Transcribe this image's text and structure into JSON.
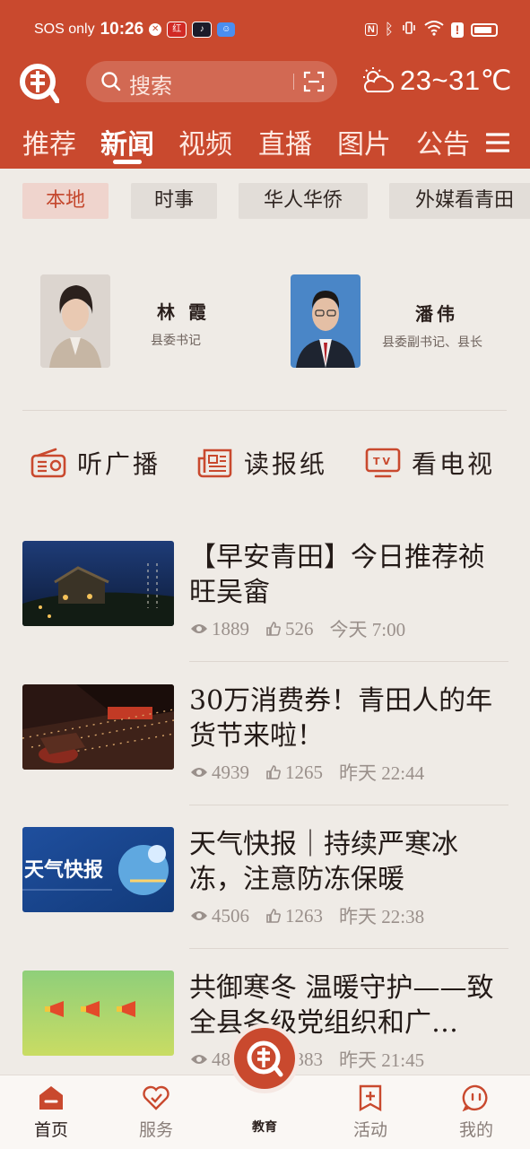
{
  "status_bar": {
    "carrier": "SOS only",
    "time": "10:26",
    "mini_icons": [
      "shield-x-icon",
      "app-badge-1-icon",
      "app-badge-2-icon",
      "app-badge-3-icon"
    ],
    "right_icons": [
      "nfc-icon",
      "bluetooth-icon",
      "vibrate-icon",
      "wifi-icon",
      "alert-icon",
      "battery-icon"
    ]
  },
  "header": {
    "search_placeholder": "搜索",
    "temperature": "23~31℃",
    "weather_icon": "partly-cloudy-icon"
  },
  "main_tabs": [
    {
      "label": "推荐",
      "active": false
    },
    {
      "label": "新闻",
      "active": true
    },
    {
      "label": "视频",
      "active": false
    },
    {
      "label": "直播",
      "active": false
    },
    {
      "label": "图片",
      "active": false
    },
    {
      "label": "公告",
      "active": false
    }
  ],
  "sub_tabs": [
    {
      "label": "本地",
      "active": true
    },
    {
      "label": "时事",
      "active": false
    },
    {
      "label": "华人华侨",
      "active": false
    },
    {
      "label": "外媒看青田",
      "active": false
    }
  ],
  "leaders": [
    {
      "name": "林 霞",
      "title": "县委书记"
    },
    {
      "name": "潘伟",
      "title": "县委副书记、县长"
    }
  ],
  "media_links": [
    {
      "label": "听广播",
      "icon": "radio-icon"
    },
    {
      "label": "读报纸",
      "icon": "newspaper-icon"
    },
    {
      "label": "看电视",
      "icon": "tv-icon"
    }
  ],
  "news": [
    {
      "title": "【早安青田】今日推荐祯旺吴畲",
      "views": "1889",
      "likes": "526",
      "time": "今天  7:00",
      "thumb_text": ""
    },
    {
      "title": "30万消费券！青田人的年货节来啦！",
      "views": "4939",
      "likes": "1265",
      "time": "昨天  22:44",
      "thumb_text": ""
    },
    {
      "title": "天气快报｜持续严寒冰冻，注意防冻保暖",
      "views": "4506",
      "likes": "1263",
      "time": "昨天  22:38",
      "thumb_text": "天气快报"
    },
    {
      "title": "共御寒冬 温暖守护——致全县各级党组织和广…",
      "views": "4818",
      "likes": "1383",
      "time": "昨天  21:45",
      "thumb_text": ""
    }
  ],
  "bottom_nav": [
    {
      "label": "首页",
      "icon": "home-icon",
      "active": true
    },
    {
      "label": "服务",
      "icon": "heart-icon",
      "active": false
    },
    {
      "label": "教育",
      "icon": "app-logo-icon",
      "active": false
    },
    {
      "label": "活动",
      "icon": "bookmark-icon",
      "active": false
    },
    {
      "label": "我的",
      "icon": "profile-icon",
      "active": false
    }
  ],
  "colors": {
    "brand": "#c9492e",
    "background": "#efebe6",
    "meta": "#9a908b"
  }
}
